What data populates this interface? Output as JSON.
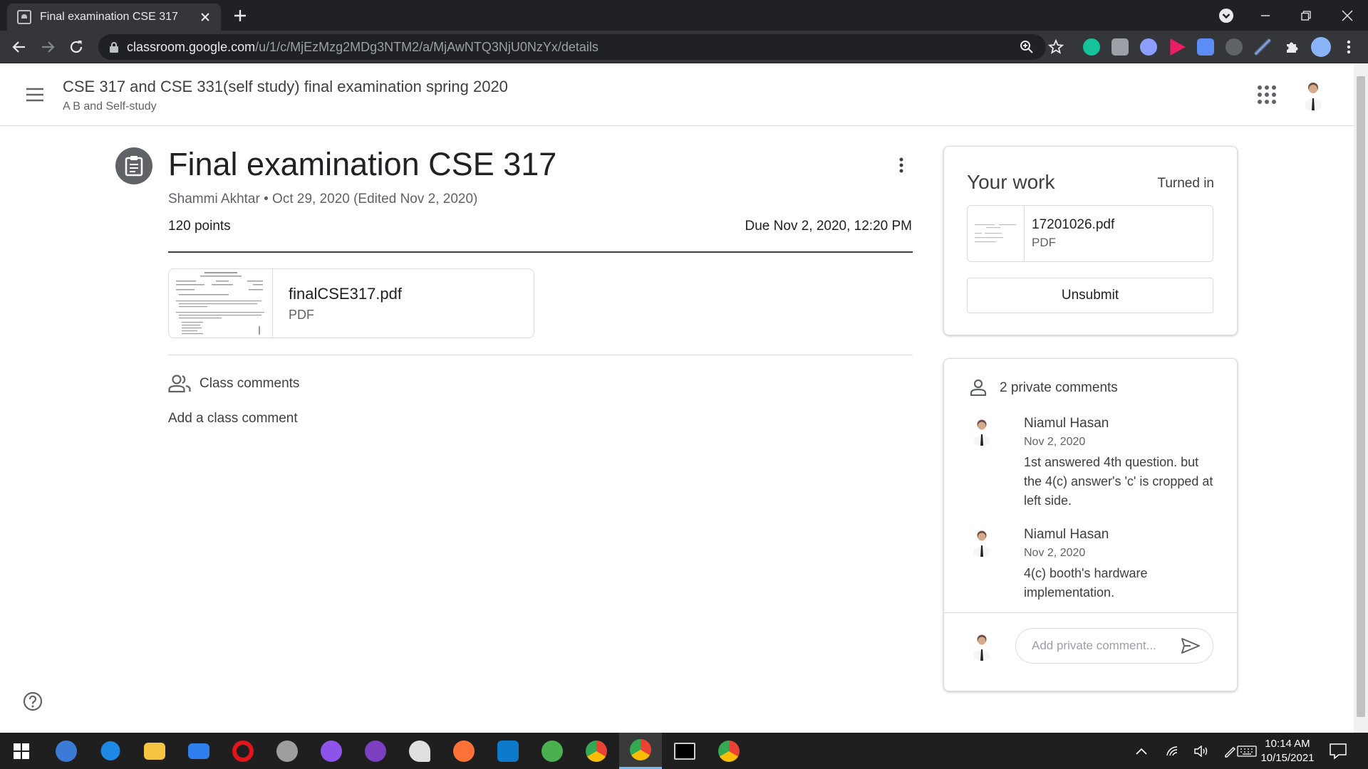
{
  "browser": {
    "tab_title": "Final examination CSE 317",
    "url_host": "classroom.google.com",
    "url_path": "/u/1/c/MjEzMzg2MDg3NTM2/a/MjAwNTQ3NjU0NzYx/details"
  },
  "appbar": {
    "course_title": "CSE 317 and CSE 331(self study) final examination spring 2020",
    "course_section": "A B and Self-study"
  },
  "assignment": {
    "title": "Final examination CSE 317",
    "meta": "Shammi Akhtar • Oct 29, 2020 (Edited Nov 2, 2020)",
    "points": "120 points",
    "due": "Due Nov 2, 2020, 12:20 PM",
    "attachment": {
      "name": "finalCSE317.pdf",
      "type": "PDF"
    }
  },
  "class_comments": {
    "label": "Class comments",
    "add_label": "Add a class comment"
  },
  "your_work": {
    "title": "Your work",
    "status": "Turned in",
    "file": {
      "name": "17201026.pdf",
      "type": "PDF"
    },
    "unsubmit_label": "Unsubmit"
  },
  "private_comments": {
    "label": "2 private comments",
    "comments": [
      {
        "author": "Niamul Hasan",
        "date": "Nov 2, 2020",
        "text": "1st answered 4th question. but the 4(c) answer's 'c' is cropped at left side."
      },
      {
        "author": "Niamul Hasan",
        "date": "Nov 2, 2020",
        "text": "4(c) booth's hardware implementation."
      }
    ],
    "input_placeholder": "Add private comment..."
  },
  "taskbar": {
    "time": "10:14 AM",
    "date": "10/15/2021"
  },
  "colors": {
    "chrome_dark": "#202124",
    "chrome_toolbar": "#35363a",
    "text_primary": "#3c4043",
    "text_secondary": "#5f6368",
    "border": "#dadce0",
    "taskbar": "#1f1f1f"
  },
  "icons": {
    "tab_favicon": "classroom-icon",
    "assignment": "assignment-icon",
    "class_comments": "people-icon",
    "private_comments": "person-icon",
    "send": "send-icon",
    "help": "help-icon"
  }
}
